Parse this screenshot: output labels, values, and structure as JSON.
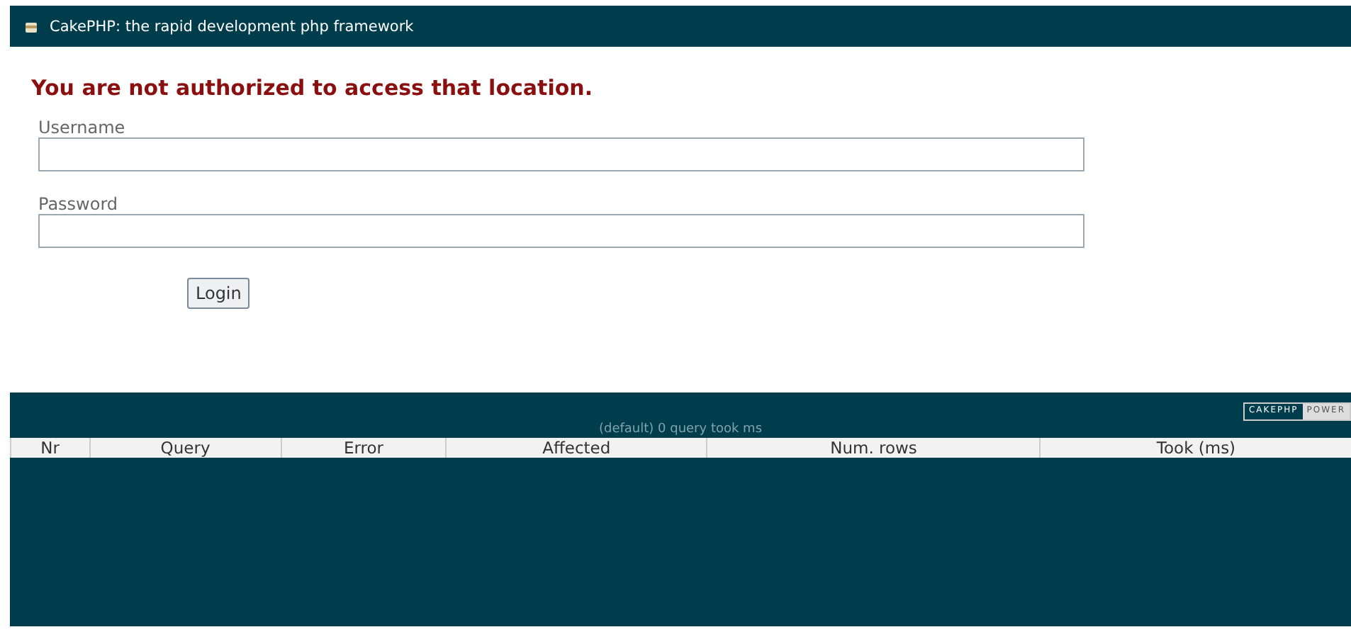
{
  "header": {
    "title": "CakePHP: the rapid development php framework"
  },
  "flash_message": "You are not authorized to access that location.",
  "form": {
    "fields": [
      {
        "label": "Username"
      },
      {
        "label": "Password"
      }
    ],
    "submit": "Login"
  },
  "footer": {
    "badge": [
      "CAKEPHP",
      "POWER"
    ]
  },
  "sql_log": {
    "caption": "(default) 0 query took ms",
    "columns": [
      "Nr",
      "Query",
      "Error",
      "Affected",
      "Num. rows",
      "Took (ms)"
    ]
  }
}
